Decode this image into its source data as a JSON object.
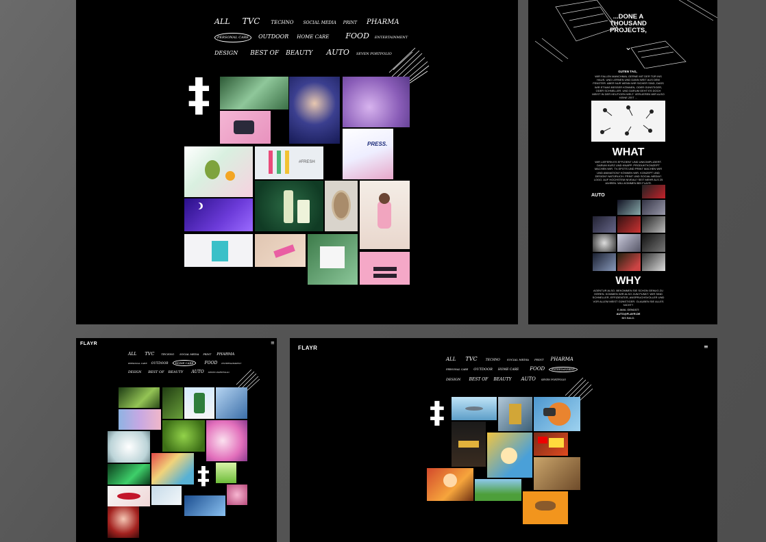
{
  "brand": "FLAYR",
  "menu_glyph": "≡",
  "hash_glyph": "‡",
  "nav": {
    "row1": [
      "ALL",
      "TVC",
      "TECHNO",
      "SOCIAL MEDIA",
      "PRINT",
      "PHARMA"
    ],
    "row2": [
      "PERSONAL CARE",
      "OUTDOOR",
      "HOME CARE",
      "FOOD",
      "ENTERTAINMENT"
    ],
    "row3": [
      "DESIGN",
      "BEST OF",
      "BEAUTY",
      "AUTO",
      "SEVEN PORTFOLIO"
    ]
  },
  "panels": {
    "main": {
      "active_filter": "PERSONAL CARE"
    },
    "bottom_left": {
      "active_filter": "HOME CARE"
    },
    "bottom_right": {
      "active_filter": "ENTERTAINMENT"
    }
  },
  "tiles_main": {
    "press_label": "PRESS.",
    "fresh_label": "#FRESH"
  },
  "side": {
    "headline": "...DONE A THOUSAND PROJECTS,",
    "chevron": "⌄",
    "intro_title": "GUTEN TAG,",
    "intro_body": "WIR FALLEN MANCHMAL GERNE MIT DER TÜR INS HAUS. UND LERNEN UND DANN WEIT AUS DEM FENSTER. ABER NUR WENN WIR SICHER SIND, DASS WIR ETWAS BESSER KÖNNEN, ODER GÜNSTIGER, ODER SCHNELLER. UND DARUM GEHT ES DOCH MEIST IN DER HEUTIGEN WELT. VERLIEREN WIR ALSO KEINE ZEIT ...",
    "what_heading": "WHAT",
    "what_body": "WIR LIEFERN ES EFFIZIENT UND UNKOMPLIZIERT. DARUM KURZ UND KNAPP: PRODUKTKONZEPT MACHEN WIR. TV-SPOTS UND PRINT MACHEN WIR UND ANIMATION? KÖNNEN WIR. KONZEPT UND DESIGN? NATÜRLICH. PRINT UND SOCIAL MEDIA? LOGO. AUF HOCHSTEM NIVEAU? SEIT MEHR ALS 25 JAHREN. WILLKOMMEN BEI FLAYR.",
    "auto_label": "AUTO",
    "why_heading": "WHY",
    "why_body": "AGENTUR ALSO. BEKOMMEN SIE SCHON GENUG ZU HÖREN. KOMMEN WIR ALSO ZUM PUNKT. WIR SIND SCHNELLER, EFFIZIENTER, ANSPRUCHSVOLLER UND VOR ALLEM MEIST GÜNSTIGER. GLAUBEN SIE ALLES NICHT?",
    "contact": "E-MAIL GENÜGT:",
    "email": "AUTO@FLAYR.DE",
    "signoff": "BIS BALD."
  },
  "colors": {
    "background": "#000000",
    "desk": "#5c5c5c",
    "text": "#ffffff"
  }
}
